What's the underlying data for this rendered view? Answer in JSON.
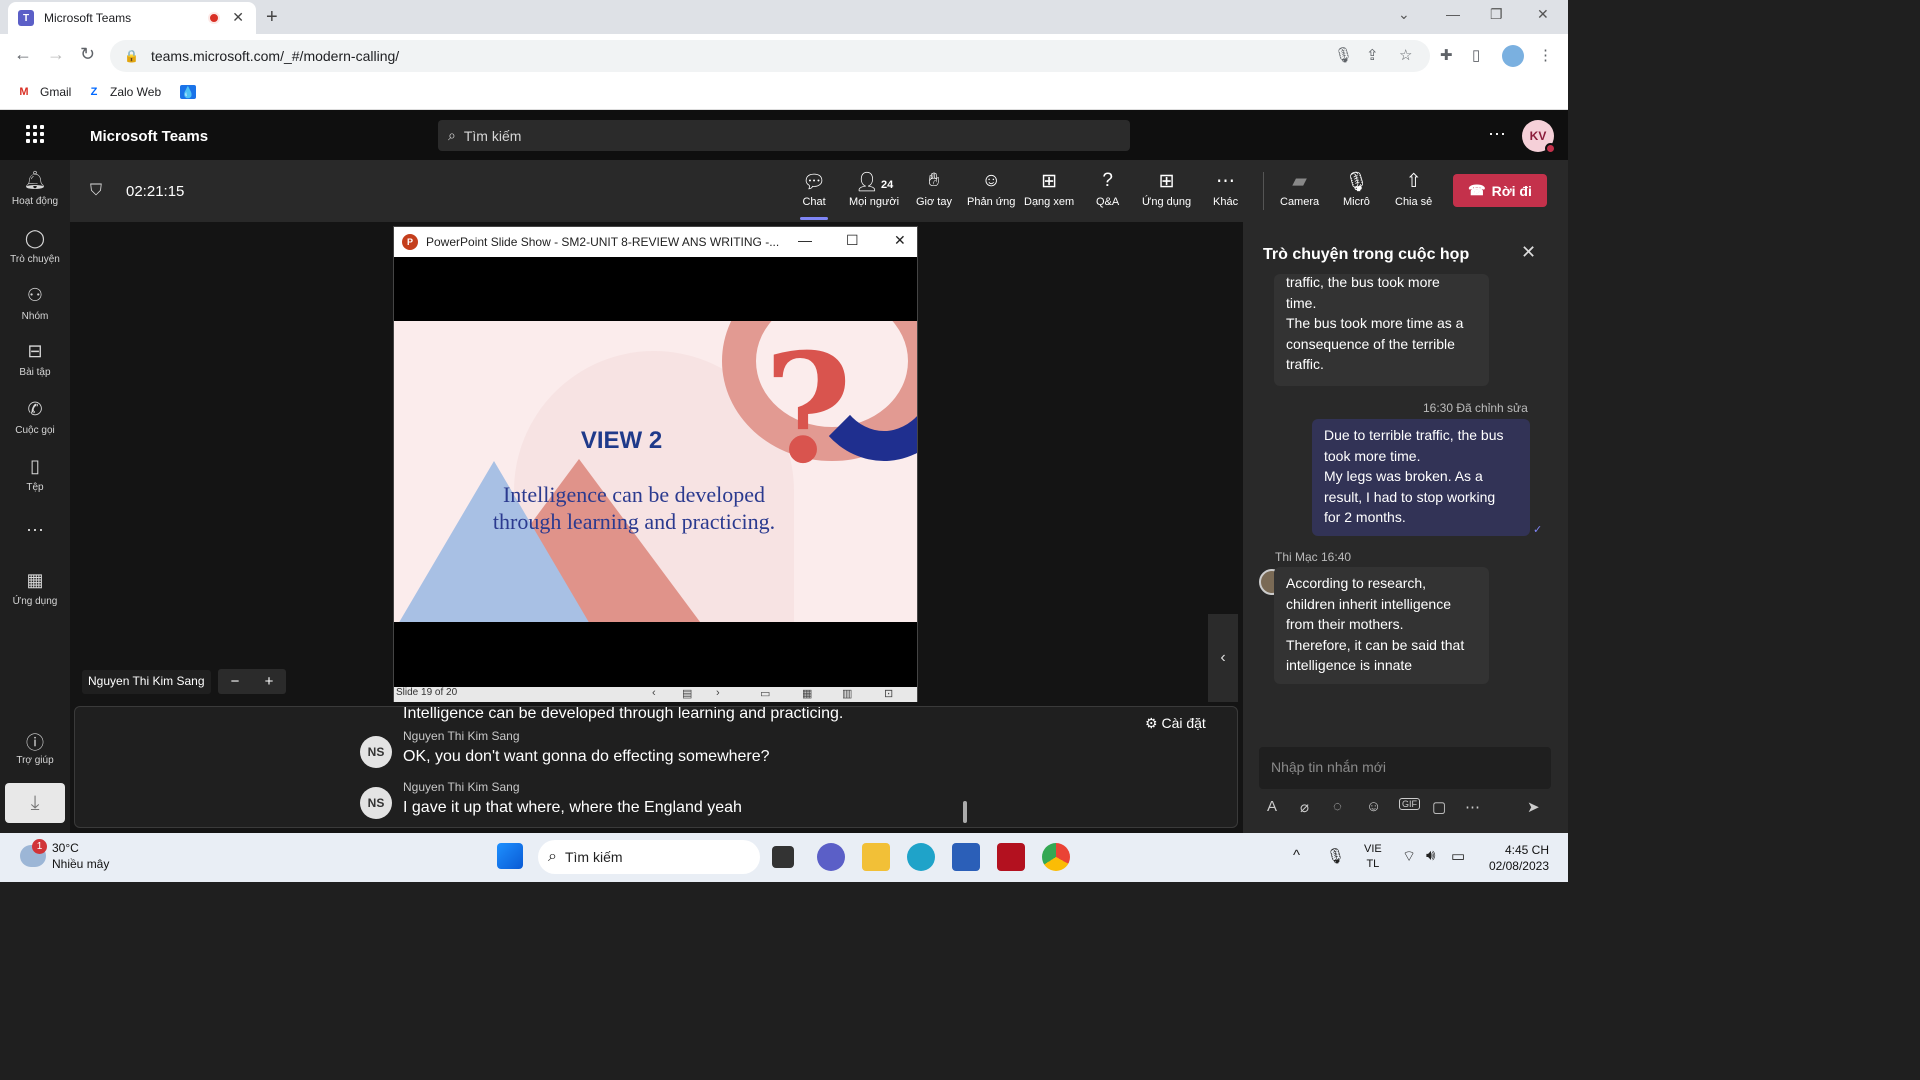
{
  "browser": {
    "tab_title": "Microsoft Teams",
    "url": "teams.microsoft.com/_#/modern-calling/",
    "bookmarks": [
      "Gmail",
      "Zalo Web"
    ]
  },
  "teams": {
    "app_title": "Microsoft Teams",
    "search_placeholder": "Tìm kiếm",
    "user_initials": "KV"
  },
  "rail": {
    "activity": "Hoạt động",
    "chat": "Trò chuyện",
    "teams": "Nhóm",
    "assignments": "Bài tập",
    "calls": "Cuộc gọi",
    "files": "Tệp",
    "apps": "Ứng dụng",
    "help": "Trợ giúp"
  },
  "meeting": {
    "timer": "02:21:15",
    "toolbar": {
      "chat": "Chat",
      "people": "Mọi người",
      "people_count": "24",
      "raise_hand": "Giơ tay",
      "react": "Phản ứng",
      "view": "Dạng xem",
      "qa": "Q&A",
      "apps": "Ứng dụng",
      "more": "Khác",
      "camera": "Camera",
      "mic": "Micrô",
      "share": "Chia sẻ",
      "leave": "Rời đi"
    },
    "participant_name": "Nguyen Thi Kim Sang"
  },
  "ppt": {
    "window_title": "PowerPoint Slide Show  -  SM2-UNIT 8-REVIEW ANS WRITING -...",
    "slide_heading": "VIEW 2",
    "slide_text": "Intelligence can be developed through learning and practicing.",
    "status": "Slide 19 of 20"
  },
  "captions": {
    "first_line": "Intelligence can be developed through learning and practicing.",
    "settings": "Cài đặt",
    "items": [
      {
        "initials": "NS",
        "name": "Nguyen Thi Kim Sang",
        "text": "OK, you don't want gonna do effecting somewhere?"
      },
      {
        "initials": "NS",
        "name": "Nguyen Thi Kim Sang",
        "text": "I gave it up that where, where the England yeah"
      }
    ]
  },
  "chat": {
    "title": "Trò chuyện trong cuộc họp",
    "msg1": {
      "lines": [
        "traffic, the bus took more",
        "time.",
        "The bus took more time as a",
        "consequence of the terrible",
        "traffic."
      ]
    },
    "msg2": {
      "meta": "16:30  Đã chỉnh sửa",
      "lines": [
        "Due to terrible traffic, the bus",
        "took more time.",
        "My legs was broken. As a",
        "result, I had to stop working",
        "for 2 months."
      ]
    },
    "msg3": {
      "meta": "Thi Mạc  16:40",
      "lines": [
        "According to research,",
        "children inherit intelligence",
        "from their mothers.",
        "Therefore, it can be said that",
        "intelligence is innate"
      ]
    },
    "compose_placeholder": "Nhập tin nhắn mới"
  },
  "taskbar": {
    "notification_count": "1",
    "temperature": "30°C",
    "weather": "Nhiều mây",
    "search": "Tìm kiếm",
    "lang_top": "VIE",
    "lang_bottom": "TL",
    "time": "4:45 CH",
    "date": "02/08/2023"
  }
}
